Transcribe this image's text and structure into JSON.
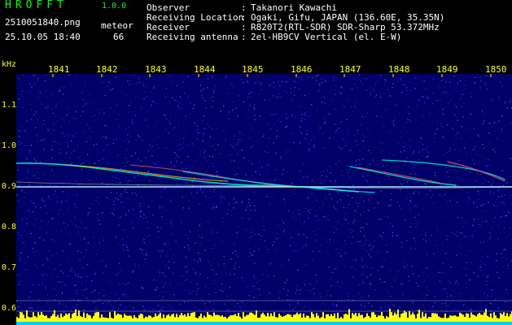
{
  "app": {
    "name": "HROFFT",
    "version": "1.0.0"
  },
  "capture": {
    "filename": "2510051840.png",
    "datetime": "25.10.05 18:40",
    "meteor_label": "meteor",
    "meteor_count": "66"
  },
  "info": [
    {
      "label": "Observer",
      "value": "Takanori Kawachi"
    },
    {
      "label": "Receiving Location",
      "value": "Ogaki, Gifu, JAPAN (136.60E, 35.35N)"
    },
    {
      "label": "Receiver",
      "value": "R820T2(RTL-SDR) SDR-Sharp 53.372MHz"
    },
    {
      "label": "Receiving antenna",
      "value": "2el-HB9CV Vertical (el. E-W)"
    }
  ],
  "colors": {
    "background": "#000000",
    "waterfall": "#000068",
    "accent_yellow": "#ffff00",
    "accent_green": "#00ff00",
    "signal_cyan": "#00ffff"
  },
  "waterfall": {
    "unit": "kHz",
    "time_ticks": [
      "1841",
      "1842",
      "1843",
      "1844",
      "1845",
      "1846",
      "1847",
      "1848",
      "1849",
      "1850"
    ],
    "freq_ticks": [
      "1.1",
      "1.0",
      "0.9",
      "0.8",
      "0.7",
      "0.6"
    ]
  }
}
